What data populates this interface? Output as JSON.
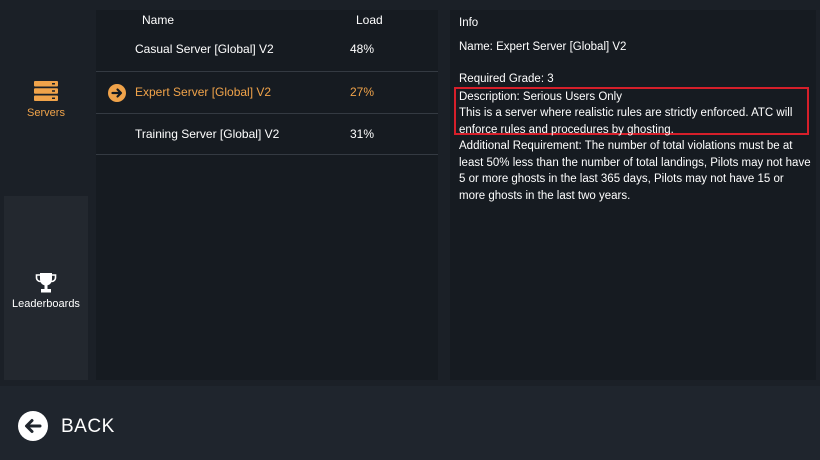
{
  "sidebar": {
    "tabs": [
      {
        "label": "Servers",
        "icon": "servers-icon",
        "selected": true
      },
      {
        "label": "Leaderboards",
        "icon": "trophy-icon",
        "selected": false
      }
    ]
  },
  "server_list": {
    "headers": {
      "name": "Name",
      "load": "Load"
    },
    "rows": [
      {
        "name": "Casual Server [Global] V2",
        "load": "48%",
        "selected": false
      },
      {
        "name": "Expert Server [Global] V2",
        "load": "27%",
        "selected": true
      },
      {
        "name": "Training Server [Global] V2",
        "load": "31%",
        "selected": false
      }
    ]
  },
  "info": {
    "title": "Info",
    "name": "Name: Expert Server [Global] V2",
    "required_grade": "Required Grade: 3",
    "description_title": "Description: Serious Users Only",
    "description_body": "This is a server where realistic rules are strictly enforced. ATC will enforce rules and procedures by ghosting.",
    "additional_requirement": "Additional Requirement: The number of total violations must be at least 50% less than the number of total landings, Pilots may not have 5 or more ghosts in the last 365 days, Pilots may not have 15 or more ghosts in the last two years."
  },
  "footer": {
    "back_label": "BACK"
  },
  "colors": {
    "accent": "#f0a34a",
    "highlight_border": "#d61f2a",
    "panel": "#161b21",
    "background": "#1b2027"
  }
}
